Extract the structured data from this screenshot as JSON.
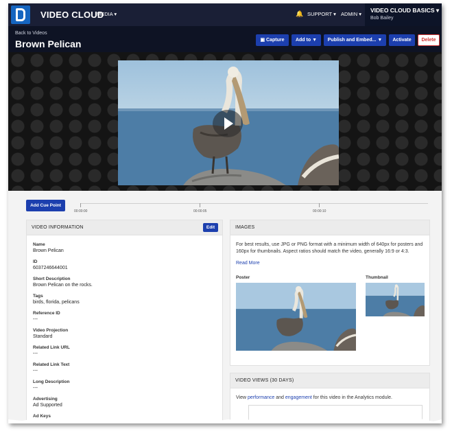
{
  "topnav": {
    "brand": "VIDEO CLOUD",
    "media": "MEDIA ▾",
    "support": "SUPPORT ▾",
    "admin": "ADMIN ▾",
    "account_name": "VIDEO CLOUD BASICS ▾",
    "user": "Bob Bailey"
  },
  "header": {
    "back": "Back to Videos",
    "title": "Brown Pelican",
    "buttons": {
      "capture": "Capture",
      "add_to": "Add to ▼",
      "publish": "Publish and Embed... ▼",
      "activate": "Activate",
      "delete": "Delete"
    }
  },
  "cue": {
    "button": "Add Cue Point",
    "ticks": [
      "00:00:00",
      "00:00:05",
      "00:00:10"
    ]
  },
  "video_info": {
    "title": "VIDEO INFORMATION",
    "edit": "Edit",
    "fields": [
      {
        "label": "Name",
        "value": "Brown Pelican"
      },
      {
        "label": "ID",
        "value": "6037246644001"
      },
      {
        "label": "Short Description",
        "value": "Brown Pelican on the rocks."
      },
      {
        "label": "Tags",
        "value": "birds, florida, pelicans"
      },
      {
        "label": "Reference ID",
        "value": "---"
      },
      {
        "label": "Video Projection",
        "value": "Standard"
      },
      {
        "label": "Related Link URL",
        "value": "---"
      },
      {
        "label": "Related Link Text",
        "value": "---"
      },
      {
        "label": "Long Description",
        "value": "---"
      },
      {
        "label": "Advertising",
        "value": "Ad Supported"
      },
      {
        "label": "Ad Keys",
        "value": ""
      }
    ]
  },
  "images": {
    "title": "IMAGES",
    "desc": "For best results, use JPG or PNG format with a minimum width of 640px for posters and 160px for thumbnails. Aspect ratios should match the video, generally 16:9 or 4:3.",
    "read_more": "Read More",
    "poster": "Poster",
    "thumbnail": "Thumbnail"
  },
  "views": {
    "title": "VIDEO VIEWS (30 DAYS)",
    "pre": "View ",
    "performance": "performance",
    "and": " and ",
    "engagement": "engagement",
    "post": " for this video in the Analytics module."
  },
  "colors": {
    "nav_bg": "#1a1f36",
    "accent": "#1c3fae",
    "delete": "#d03030"
  }
}
